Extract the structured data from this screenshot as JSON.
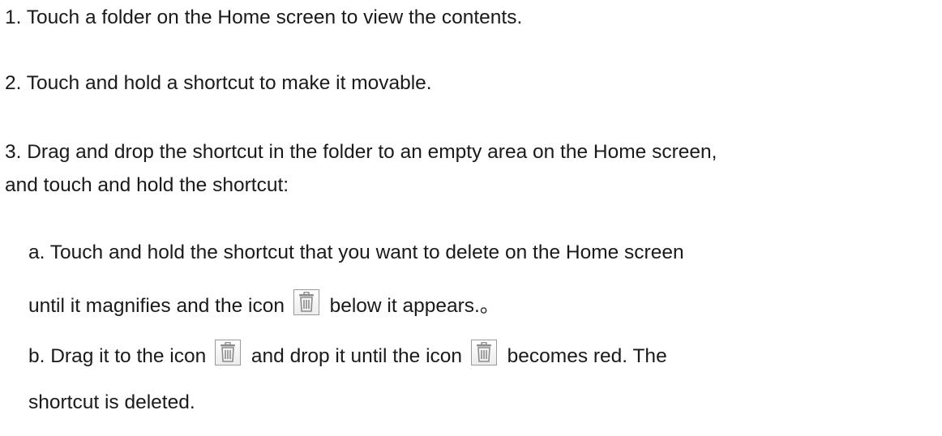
{
  "steps": [
    {
      "text": "1. Touch a folder on the Home screen to view the contents."
    },
    {
      "text": "2. Touch and hold a shortcut to make it movable."
    },
    {
      "lines": [
        "3. Drag and drop the shortcut in the folder to an empty area on the Home screen,",
        "and touch and hold the shortcut:"
      ]
    }
  ],
  "substeps": {
    "a": {
      "line1": "a. Touch and hold the shortcut that you want to delete on the Home screen",
      "line2_before": "until it magnifies and the icon",
      "line2_after": "below it appears.。"
    },
    "b": {
      "part1": "b. Drag it to the icon",
      "part2": "and drop it until the icon",
      "part3": "becomes red. The",
      "line2": "shortcut is deleted."
    }
  },
  "icons": {
    "trash": "trash-icon"
  }
}
